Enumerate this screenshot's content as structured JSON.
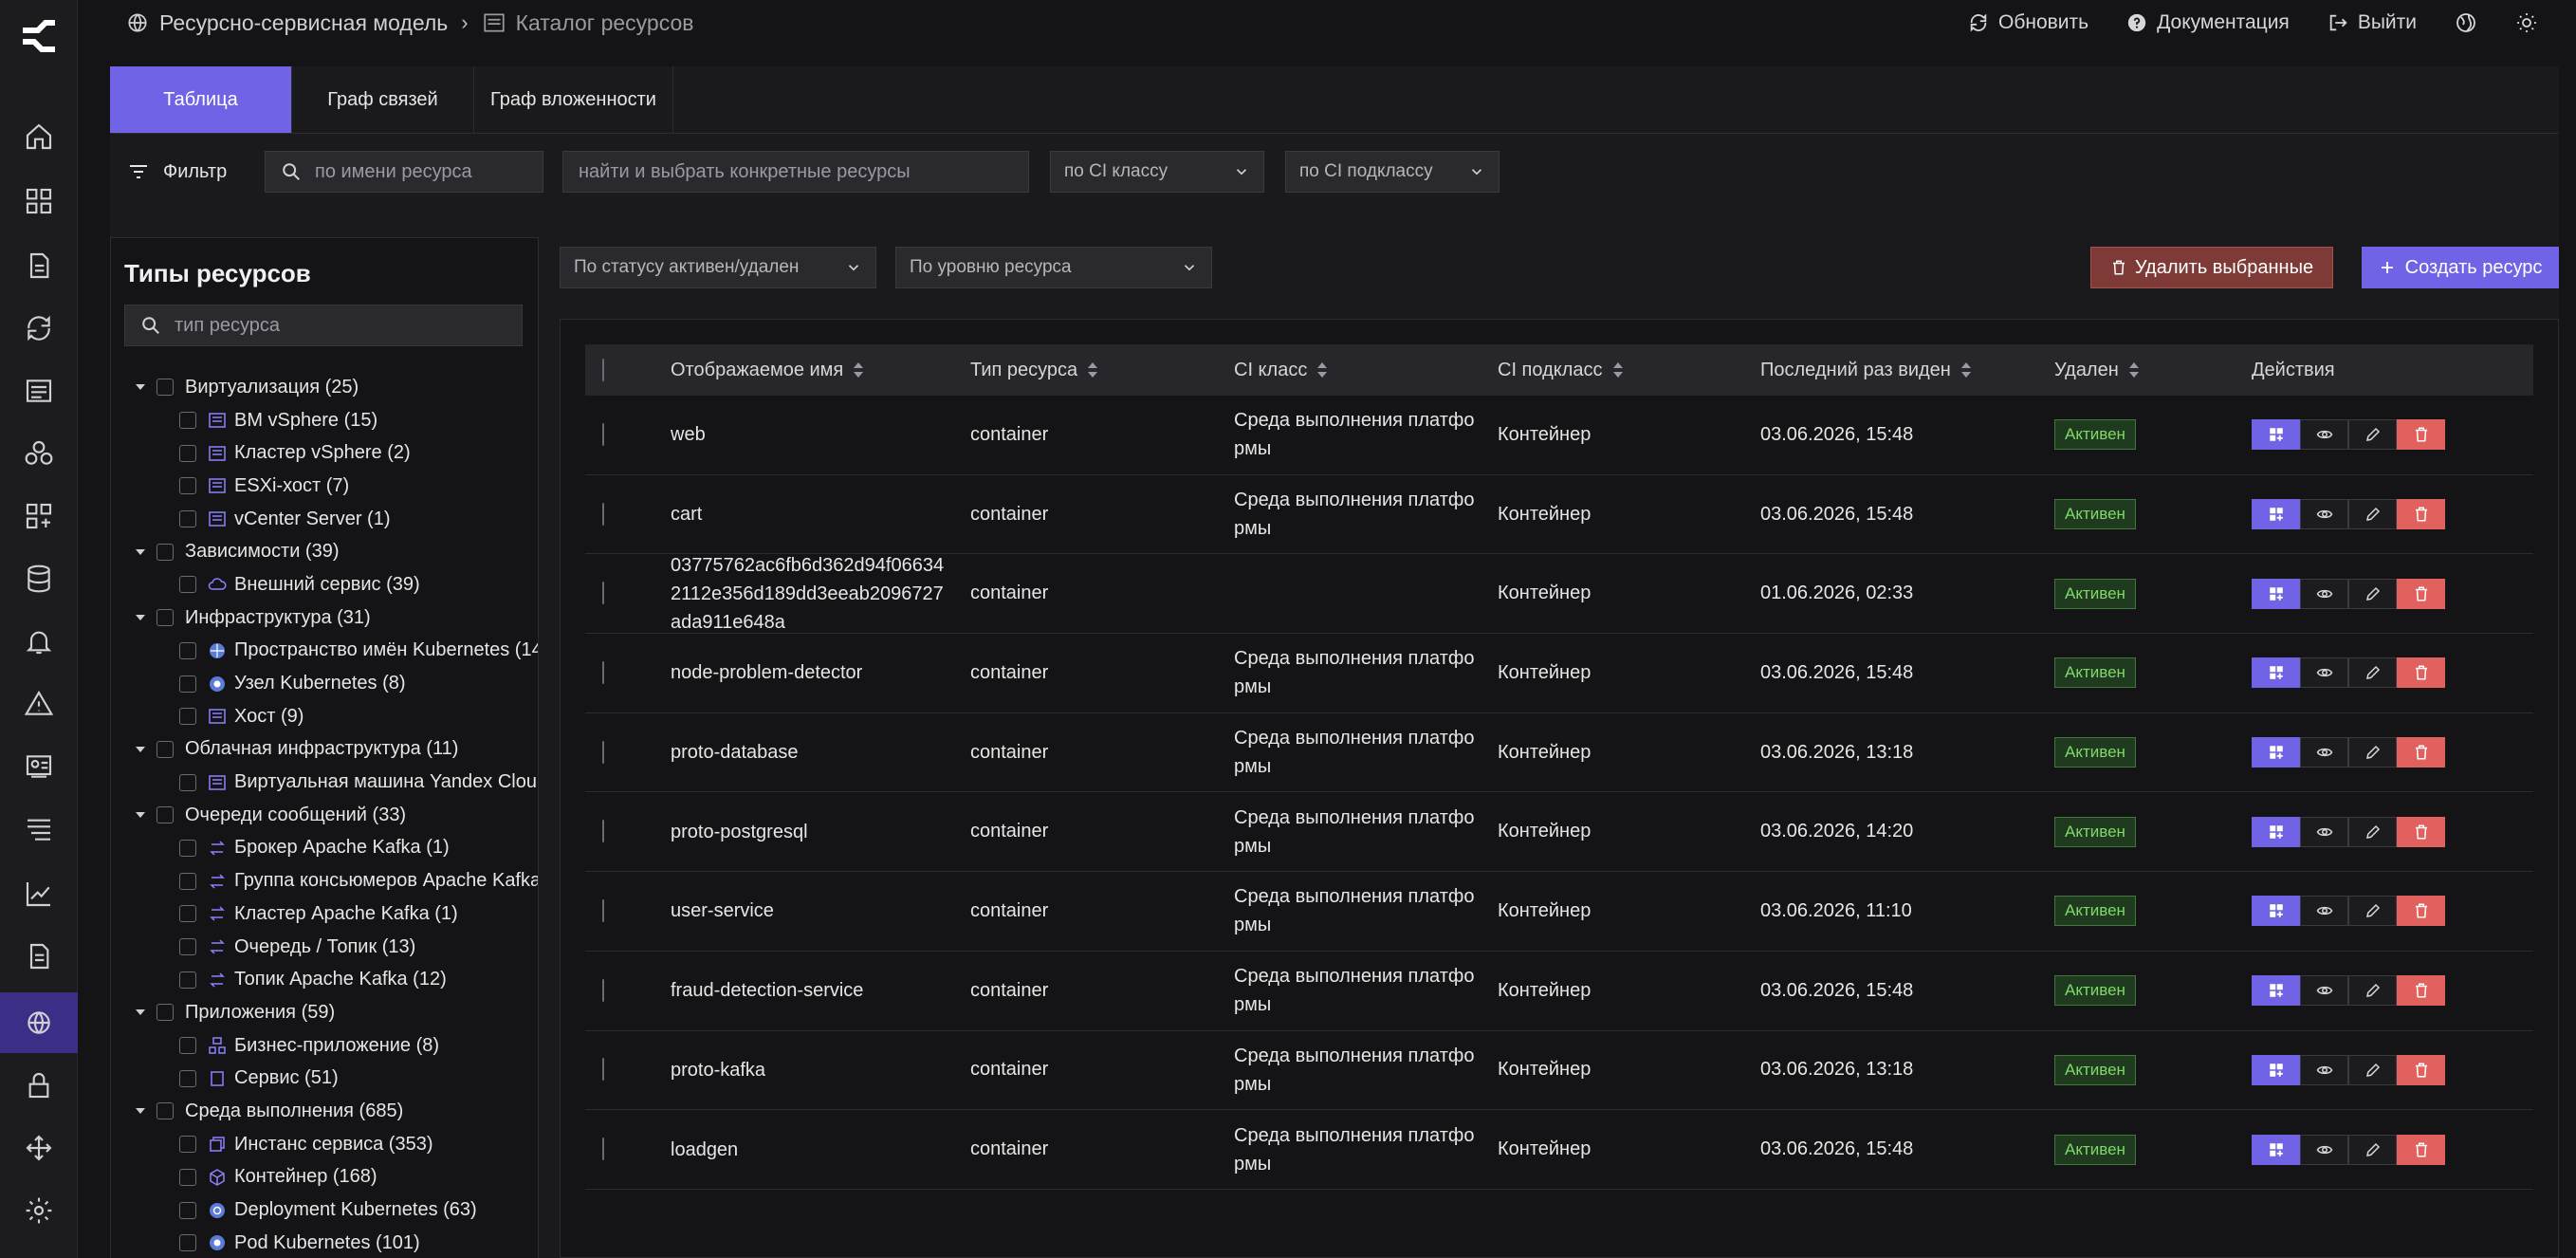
{
  "breadcrumb": {
    "first": "Ресурсно-сервисная модель",
    "second": "Каталог ресурсов"
  },
  "header_actions": {
    "refresh": "Обновить",
    "docs": "Документация",
    "logout": "Выйти"
  },
  "tabs": [
    {
      "label": "Таблица",
      "active": true
    },
    {
      "label": "Граф связей"
    },
    {
      "label": "Граф вложенности"
    }
  ],
  "filter": {
    "label": "Фильтр",
    "name_placeholder": "по имени ресурса",
    "select_placeholder": "найти и выбрать конкретные ресурсы",
    "ci_class": "по CI классу",
    "ci_subclass": "по CI подклассу",
    "status": "По статусу активен/удален",
    "level": "По уровню ресурса"
  },
  "sidebar": {
    "title": "Типы ресурсов",
    "search_placeholder": "тип ресурса",
    "groups": [
      {
        "label": "Виртуализация (25)",
        "children": [
          "ВМ vSphere (15)",
          "Кластер vSphere (2)",
          "ESXi-хост (7)",
          "vCenter Server (1)"
        ]
      },
      {
        "label": "Зависимости (39)",
        "children": [
          "Внешний сервис (39)"
        ]
      },
      {
        "label": "Инфраструктура (31)",
        "children": [
          "Пространство имён Kubernetes (14",
          "Узел Kubernetes (8)",
          "Хост (9)"
        ]
      },
      {
        "label": "Облачная инфраструктура (11)",
        "children": [
          "Виртуальная машина Yandex Clou"
        ]
      },
      {
        "label": "Очереди сообщений (33)",
        "children": [
          "Брокер Apache Kafka (1)",
          "Группа консьюмеров Apache Kafka",
          "Кластер Apache Kafka (1)",
          "Очередь / Топик (13)",
          "Топик Apache Kafka (12)"
        ]
      },
      {
        "label": "Приложения (59)",
        "children": [
          "Бизнес-приложение (8)",
          "Сервис (51)"
        ]
      },
      {
        "label": "Среда выполнения (685)",
        "children": [
          "Инстанс сервиса (353)",
          "Контейнер (168)",
          "Deployment Kubernetes (63)",
          "Pod Kubernetes (101)"
        ]
      }
    ]
  },
  "buttons": {
    "delete_selected": "Удалить выбранные",
    "create_resource": "Создать ресурс"
  },
  "table": {
    "headers": [
      "Отображаемое имя",
      "Тип ресурса",
      "CI класс",
      "CI подкласс",
      "Последний раз виден",
      "Удален",
      "Действия"
    ],
    "rows": [
      {
        "name": "web",
        "type": "container",
        "ci_class": "Среда выполнения платфо рмы",
        "ci_sub": "Контейнер",
        "seen": "03.06.2026, 15:48",
        "status": "Активен"
      },
      {
        "name": "cart",
        "type": "container",
        "ci_class": "Среда выполнения платфо рмы",
        "ci_sub": "Контейнер",
        "seen": "03.06.2026, 15:48",
        "status": "Активен"
      },
      {
        "name": "03775762ac6fb6d362d94f06634 2112e356d189dd3eeab2096727 ada911e648a",
        "type": "container",
        "ci_class": "",
        "ci_sub": "Контейнер",
        "seen": "01.06.2026, 02:33",
        "status": "Активен"
      },
      {
        "name": "node-problem-detector",
        "type": "container",
        "ci_class": "Среда выполнения платфо рмы",
        "ci_sub": "Контейнер",
        "seen": "03.06.2026, 15:48",
        "status": "Активен"
      },
      {
        "name": "proto-database",
        "type": "container",
        "ci_class": "Среда выполнения платфо рмы",
        "ci_sub": "Контейнер",
        "seen": "03.06.2026, 13:18",
        "status": "Активен"
      },
      {
        "name": "proto-postgresql",
        "type": "container",
        "ci_class": "Среда выполнения платфо рмы",
        "ci_sub": "Контейнер",
        "seen": "03.06.2026, 14:20",
        "status": "Активен"
      },
      {
        "name": "user-service",
        "type": "container",
        "ci_class": "Среда выполнения платфо рмы",
        "ci_sub": "Контейнер",
        "seen": "03.06.2026, 11:10",
        "status": "Активен"
      },
      {
        "name": "fraud-detection-service",
        "type": "container",
        "ci_class": "Среда выполнения платфо рмы",
        "ci_sub": "Контейнер",
        "seen": "03.06.2026, 15:48",
        "status": "Активен"
      },
      {
        "name": "proto-kafka",
        "type": "container",
        "ci_class": "Среда выполнения платфо рмы",
        "ci_sub": "Контейнер",
        "seen": "03.06.2026, 13:18",
        "status": "Активен"
      },
      {
        "name": "loadgen",
        "type": "container",
        "ci_class": "Среда выполнения платфо рмы",
        "ci_sub": "Контейнер",
        "seen": "03.06.2026, 15:48",
        "status": "Активен"
      }
    ]
  },
  "colors": {
    "accent": "#7063e5",
    "danger": "#e0615e",
    "active_badge": "#7fd96a"
  }
}
